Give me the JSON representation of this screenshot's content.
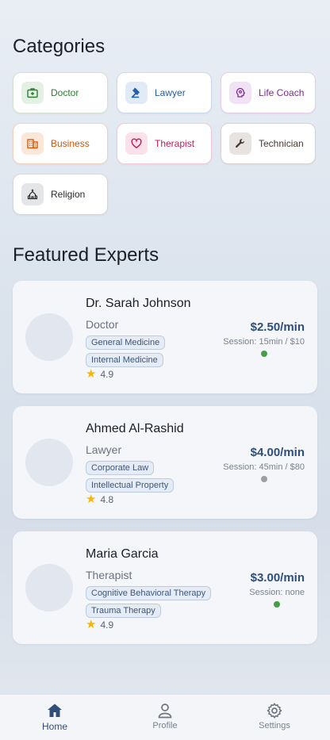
{
  "categories_title": "Categories",
  "categories": [
    {
      "label": "Doctor",
      "icon": "medical-bag-icon",
      "color": "#2e7d32",
      "bg": "#e3f1e4",
      "border": "#cfe3d0"
    },
    {
      "label": "Lawyer",
      "icon": "gavel-icon",
      "color": "#1f5fa8",
      "bg": "#e1ebf7",
      "border": "#cad9ec"
    },
    {
      "label": "Life Coach",
      "icon": "brain-icon",
      "color": "#7b2a8f",
      "bg": "#f1e3f5",
      "border": "#e3cde9"
    },
    {
      "label": "Business",
      "icon": "building-icon",
      "color": "#d35400",
      "bg": "#fbe7d9",
      "border": "#f2d1bc"
    },
    {
      "label": "Therapist",
      "icon": "heart-icon",
      "color": "#c2185b",
      "bg": "#fbe1ea",
      "border": "#f1c9d7"
    },
    {
      "label": "Technician",
      "icon": "wrench-icon",
      "color": "#4a3a33",
      "bg": "#e6e3e1",
      "border": "#d6d3d0"
    },
    {
      "label": "Religion",
      "icon": "temple-icon",
      "color": "#2a2a2a",
      "bg": "#e4e5e7",
      "border": "#d3d6da"
    }
  ],
  "featured_title": "Featured Experts",
  "experts": [
    {
      "name": "Dr. Sarah Johnson",
      "profession": "Doctor",
      "tags": [
        "General Medicine",
        "Internal Medicine"
      ],
      "rating": "4.9",
      "price": "$2.50/min",
      "session": "Session: 15min / $10",
      "status_color": "#43a047"
    },
    {
      "name": "Ahmed Al-Rashid",
      "profession": "Lawyer",
      "tags": [
        "Corporate Law",
        "Intellectual Property"
      ],
      "rating": "4.8",
      "price": "$4.00/min",
      "session": "Session: 45min / $80",
      "status_color": "#9e9e9e"
    },
    {
      "name": "Maria Garcia",
      "profession": "Therapist",
      "tags": [
        "Cognitive Behavioral Therapy",
        "Trauma Therapy"
      ],
      "rating": "4.9",
      "price": "$3.00/min",
      "session": "Session: none",
      "status_color": "#43a047"
    }
  ],
  "nav": [
    {
      "label": "Home",
      "icon": "home-icon",
      "active": true
    },
    {
      "label": "Profile",
      "icon": "person-icon",
      "active": false
    },
    {
      "label": "Settings",
      "icon": "gear-icon",
      "active": false
    }
  ],
  "colors": {
    "accent": "#2f4f7a",
    "star": "#f5b50a"
  }
}
